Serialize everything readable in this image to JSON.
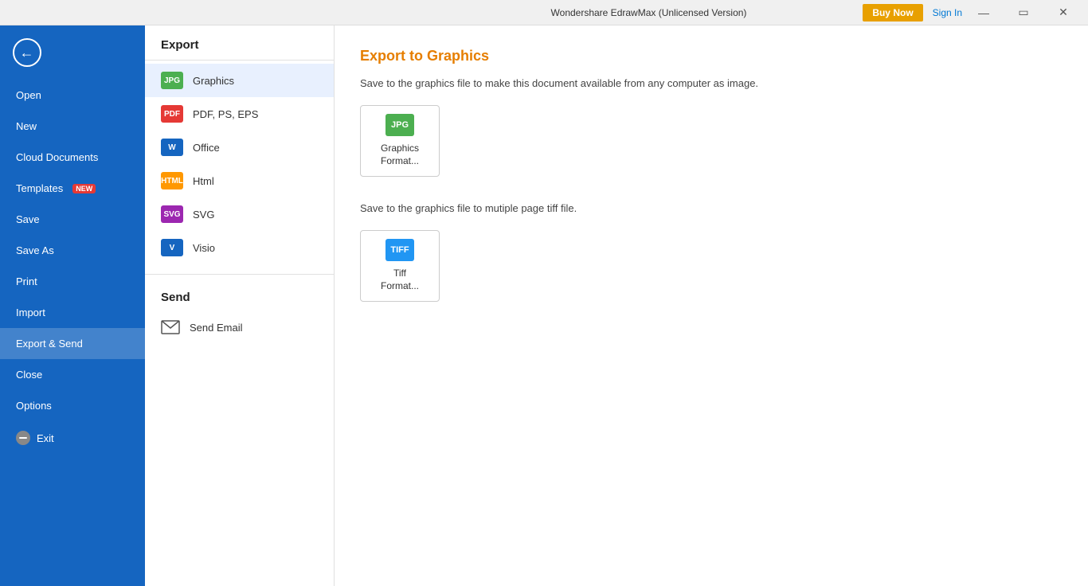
{
  "titleBar": {
    "title": "Wondershare EdrawMax (Unlicensed Version)",
    "buyNow": "Buy Now",
    "signIn": "Sign In",
    "minimize": "—",
    "restore": "❐",
    "close": "✕"
  },
  "sidebar": {
    "backLabel": "←",
    "items": [
      {
        "id": "open",
        "label": "Open",
        "badge": null
      },
      {
        "id": "new",
        "label": "New",
        "badge": null
      },
      {
        "id": "cloud-documents",
        "label": "Cloud Documents",
        "badge": null
      },
      {
        "id": "templates",
        "label": "Templates",
        "badge": "NEW"
      },
      {
        "id": "save",
        "label": "Save",
        "badge": null
      },
      {
        "id": "save-as",
        "label": "Save As",
        "badge": null
      },
      {
        "id": "print",
        "label": "Print",
        "badge": null
      },
      {
        "id": "import",
        "label": "Import",
        "badge": null
      },
      {
        "id": "export-send",
        "label": "Export & Send",
        "badge": null
      },
      {
        "id": "close",
        "label": "Close",
        "badge": null
      },
      {
        "id": "options",
        "label": "Options",
        "badge": null
      },
      {
        "id": "exit",
        "label": "Exit",
        "badge": null
      }
    ]
  },
  "middlePanel": {
    "exportHeader": "Export",
    "exportItems": [
      {
        "id": "graphics",
        "label": "Graphics",
        "iconText": "JPG",
        "iconClass": "icon-jpg"
      },
      {
        "id": "pdf",
        "label": "PDF, PS, EPS",
        "iconText": "PDF",
        "iconClass": "icon-pdf"
      },
      {
        "id": "office",
        "label": "Office",
        "iconText": "W",
        "iconClass": "icon-word"
      },
      {
        "id": "html",
        "label": "Html",
        "iconText": "HTML",
        "iconClass": "icon-html"
      },
      {
        "id": "svg",
        "label": "SVG",
        "iconText": "SVG",
        "iconClass": "icon-svg"
      },
      {
        "id": "visio",
        "label": "Visio",
        "iconText": "V",
        "iconClass": "icon-visio"
      }
    ],
    "sendHeader": "Send",
    "sendItems": [
      {
        "id": "send-email",
        "label": "Send Email"
      }
    ]
  },
  "mainContent": {
    "title": "Export to Graphics",
    "desc1": "Save to the graphics file to make this document available from any computer as image.",
    "desc2": "Save to the graphics file to mutiple page tiff file.",
    "cards": [
      {
        "id": "graphics-format",
        "iconText": "JPG",
        "iconClass": "card-icon-jpg",
        "label": "Graphics\nFormat..."
      },
      {
        "id": "tiff-format",
        "iconText": "TIFF",
        "iconClass": "card-icon-tiff",
        "label": "Tiff\nFormat..."
      }
    ]
  }
}
